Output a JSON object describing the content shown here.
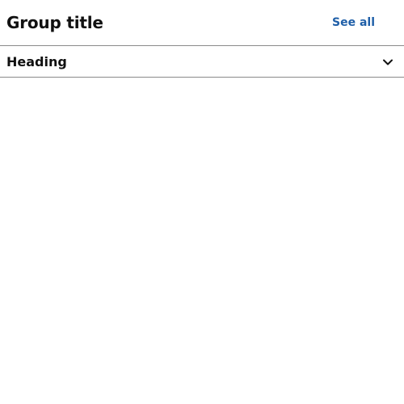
{
  "group": {
    "title": "Group title",
    "see_all_label": "See all"
  },
  "accordion": {
    "heading": "Heading",
    "expanded": false,
    "toggle_icon": "chevron-down-icon"
  },
  "colors": {
    "link": "#1f5fa8",
    "text": "#111111",
    "divider": "#8a8a8a",
    "background": "#ffffff"
  }
}
